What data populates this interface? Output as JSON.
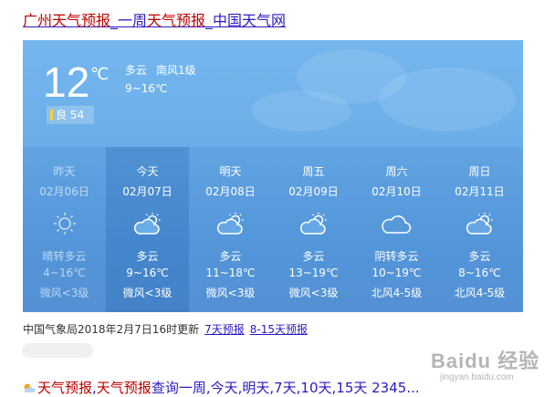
{
  "result_title": {
    "part1_hl": "广州天气预报",
    "part2": "_一周",
    "part3_hl": "天气预报",
    "part4": "_中国天气网"
  },
  "current": {
    "temp": "12",
    "unit": "℃",
    "condition": "多云",
    "wind": "南风1级",
    "range": "9~16℃",
    "aqi_label": "良",
    "aqi_value": "54",
    "aqi_color": "#f6d23a"
  },
  "forecast": [
    {
      "day": "昨天",
      "date": "02月06日",
      "icon": "sun-icon",
      "condition": "晴转多云",
      "temp": "4~16℃",
      "wind": "微风<3级"
    },
    {
      "day": "今天",
      "date": "02月07日",
      "icon": "partly-cloudy-icon",
      "condition": "多云",
      "temp": "9~16℃",
      "wind": "微风<3级"
    },
    {
      "day": "明天",
      "date": "02月08日",
      "icon": "partly-cloudy-icon",
      "condition": "多云",
      "temp": "11~18℃",
      "wind": "微风<3级"
    },
    {
      "day": "周五",
      "date": "02月09日",
      "icon": "partly-cloudy-icon",
      "condition": "多云",
      "temp": "13~19℃",
      "wind": "微风<3级"
    },
    {
      "day": "周六",
      "date": "02月10日",
      "icon": "cloud-icon",
      "condition": "阴转多云",
      "temp": "10~19℃",
      "wind": "北风4-5级"
    },
    {
      "day": "周日",
      "date": "02月11日",
      "icon": "partly-cloudy-icon",
      "condition": "多云",
      "temp": "8~16℃",
      "wind": "北风4-5级"
    }
  ],
  "update": {
    "text": "中国气象局2018年2月7日16时更新",
    "link1": "7天预报",
    "link2": "8-15天预报"
  },
  "next_result": {
    "part1_hl": "天气预报",
    "part2": ",",
    "part3_hl": "天气预报",
    "part4": "查询一周,今天,明天,7天,10天,15天",
    "part5": "  2345..."
  },
  "watermark": {
    "brand": "Baidu 经验",
    "site": "jingyan.baidu.com"
  }
}
